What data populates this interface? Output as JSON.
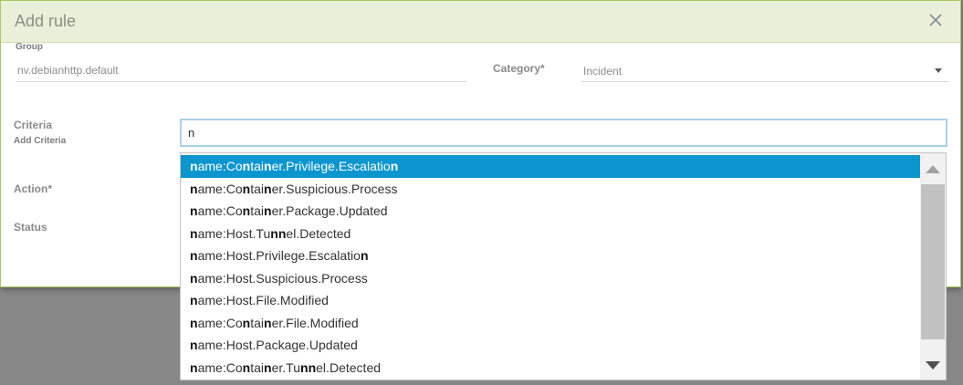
{
  "dialog": {
    "title": "Add rule",
    "close_icon": "close-icon"
  },
  "form": {
    "group_label": "Group",
    "group_value": "nv.debianhttp.default",
    "category_label": "Category*",
    "category_value": "Incident",
    "criteria_label": "Criteria",
    "add_criteria_label": "Add Criteria",
    "criteria_input_value": "n",
    "action_label": "Action*",
    "status_label": "Status"
  },
  "dropdown": {
    "items": [
      {
        "label": "name:Container.Privilege.Escalation",
        "selected": true
      },
      {
        "label": "name:Container.Suspicious.Process",
        "selected": false
      },
      {
        "label": "name:Container.Package.Updated",
        "selected": false
      },
      {
        "label": "name:Host.Tunnel.Detected",
        "selected": false
      },
      {
        "label": "name:Host.Privilege.Escalation",
        "selected": false
      },
      {
        "label": "name:Host.Suspicious.Process",
        "selected": false
      },
      {
        "label": "name:Host.File.Modified",
        "selected": false
      },
      {
        "label": "name:Container.File.Modified",
        "selected": false
      },
      {
        "label": "name:Host.Package.Updated",
        "selected": false
      },
      {
        "label": "name:Container.Tunnel.Detected",
        "selected": false
      }
    ]
  },
  "colors": {
    "header_bg": "#eaefd9",
    "dialog_border": "#a5c95d",
    "selected_bg": "#0c96d0",
    "input_focus_border": "#a9cfe8"
  }
}
